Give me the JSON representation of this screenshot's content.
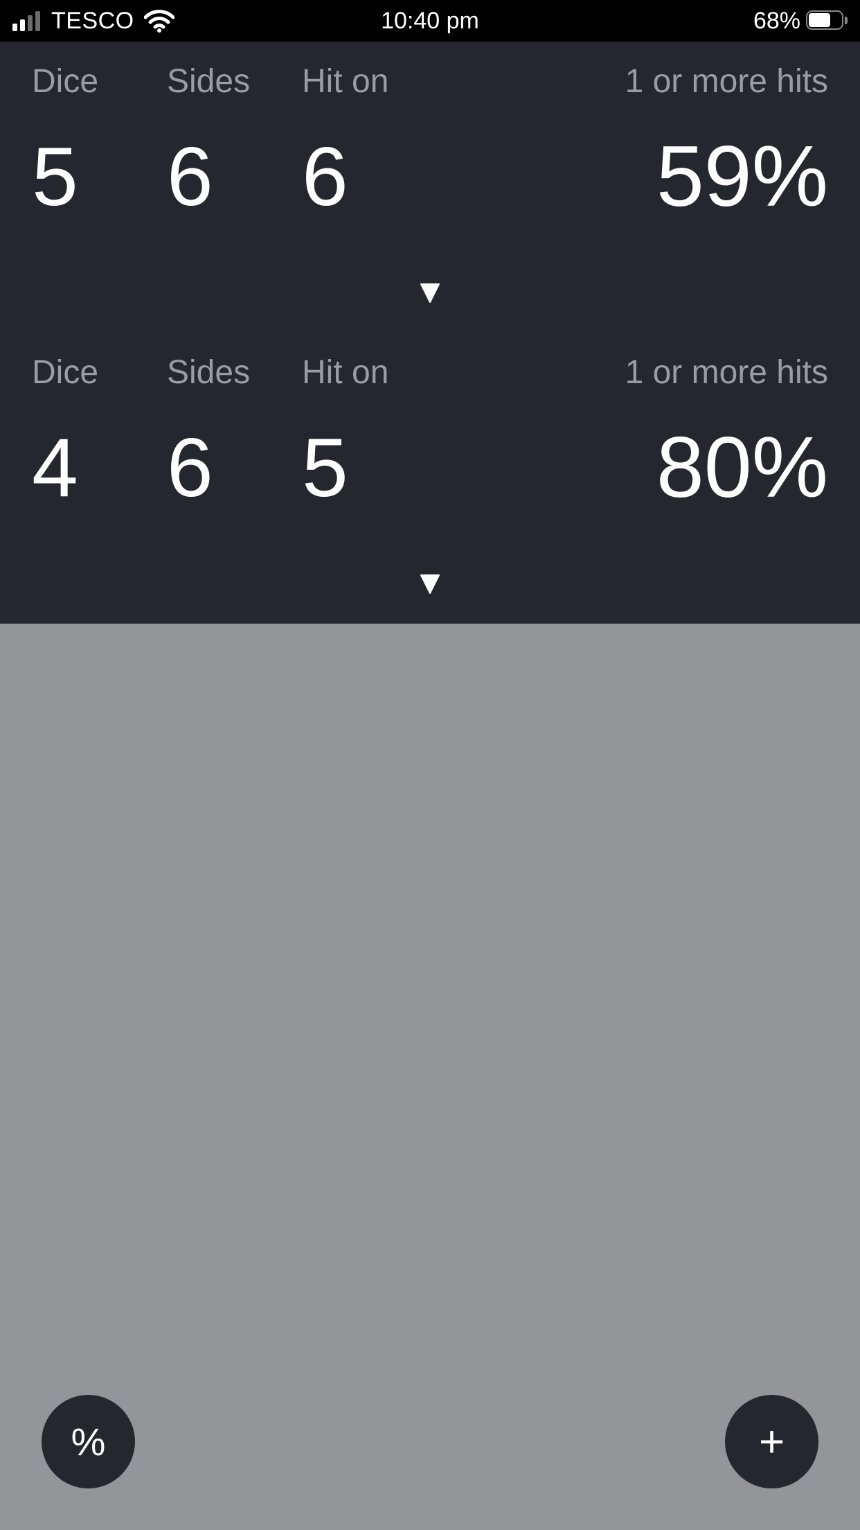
{
  "status_bar": {
    "carrier": "TESCO",
    "time": "10:40 pm",
    "battery_percent": "68%",
    "battery_level": 0.68
  },
  "rows": [
    {
      "dice_label": "Dice",
      "sides_label": "Sides",
      "hit_label": "Hit on",
      "result_label": "1 or more hits",
      "dice": "5",
      "sides": "6",
      "hit_on": "6",
      "result": "59%"
    },
    {
      "dice_label": "Dice",
      "sides_label": "Sides",
      "hit_label": "Hit on",
      "result_label": "1 or more hits",
      "dice": "4",
      "sides": "6",
      "hit_on": "5",
      "result": "80%"
    }
  ],
  "actions": {
    "percent_label": "%",
    "add_label": "+"
  },
  "colors": {
    "panel": "#25272e",
    "background": "#949599",
    "label": "#9a9ca1",
    "value": "#ffffff"
  }
}
